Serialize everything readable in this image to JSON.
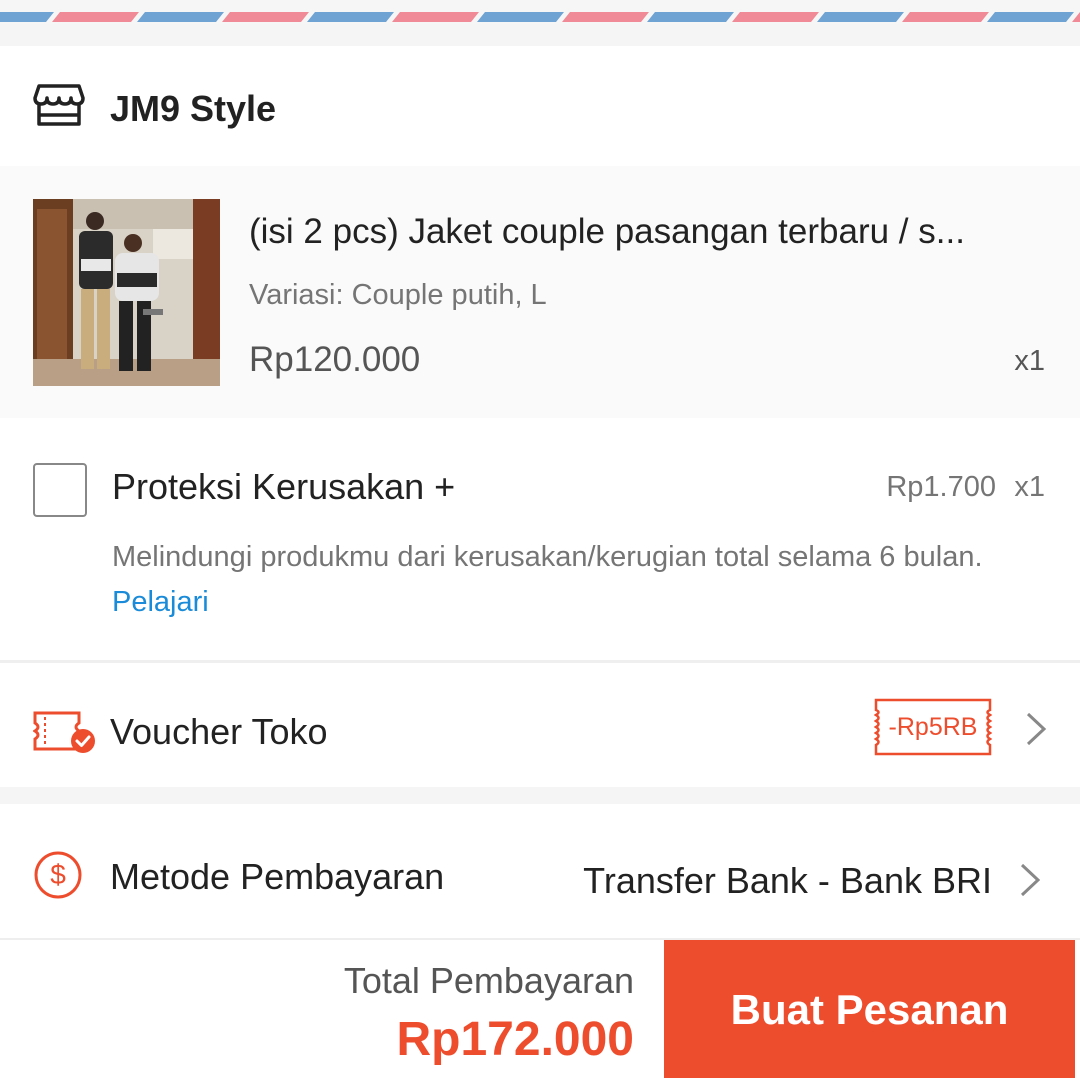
{
  "shop": {
    "name": "JM9 Style",
    "icon": "store-icon"
  },
  "product": {
    "title": "(isi 2 pcs) Jaket couple pasangan terbaru / s...",
    "variation": "Variasi: Couple putih, L",
    "price": "Rp120.000",
    "quantity": "x1"
  },
  "protection": {
    "title": "Proteksi Kerusakan +",
    "price": "Rp1.700",
    "quantity": "x1",
    "description": "Melindungi produkmu dari kerusakan/kerugian total selama 6 bulan.",
    "link_label": "Pelajari",
    "checked": false
  },
  "voucher": {
    "label": "Voucher Toko",
    "badge": "-Rp5RB",
    "icon": "voucher-icon"
  },
  "payment": {
    "label": "Metode Pembayaran",
    "value": "Transfer Bank - Bank BRI",
    "icon": "dollar-icon"
  },
  "footer": {
    "total_label": "Total Pembayaran",
    "total_value": "Rp172.000",
    "order_button": "Buat Pesanan"
  },
  "colors": {
    "accent": "#ee4d2d",
    "link": "#1a8bd8",
    "stripe_red": "#f08a96",
    "stripe_blue": "#6fa3d3"
  }
}
